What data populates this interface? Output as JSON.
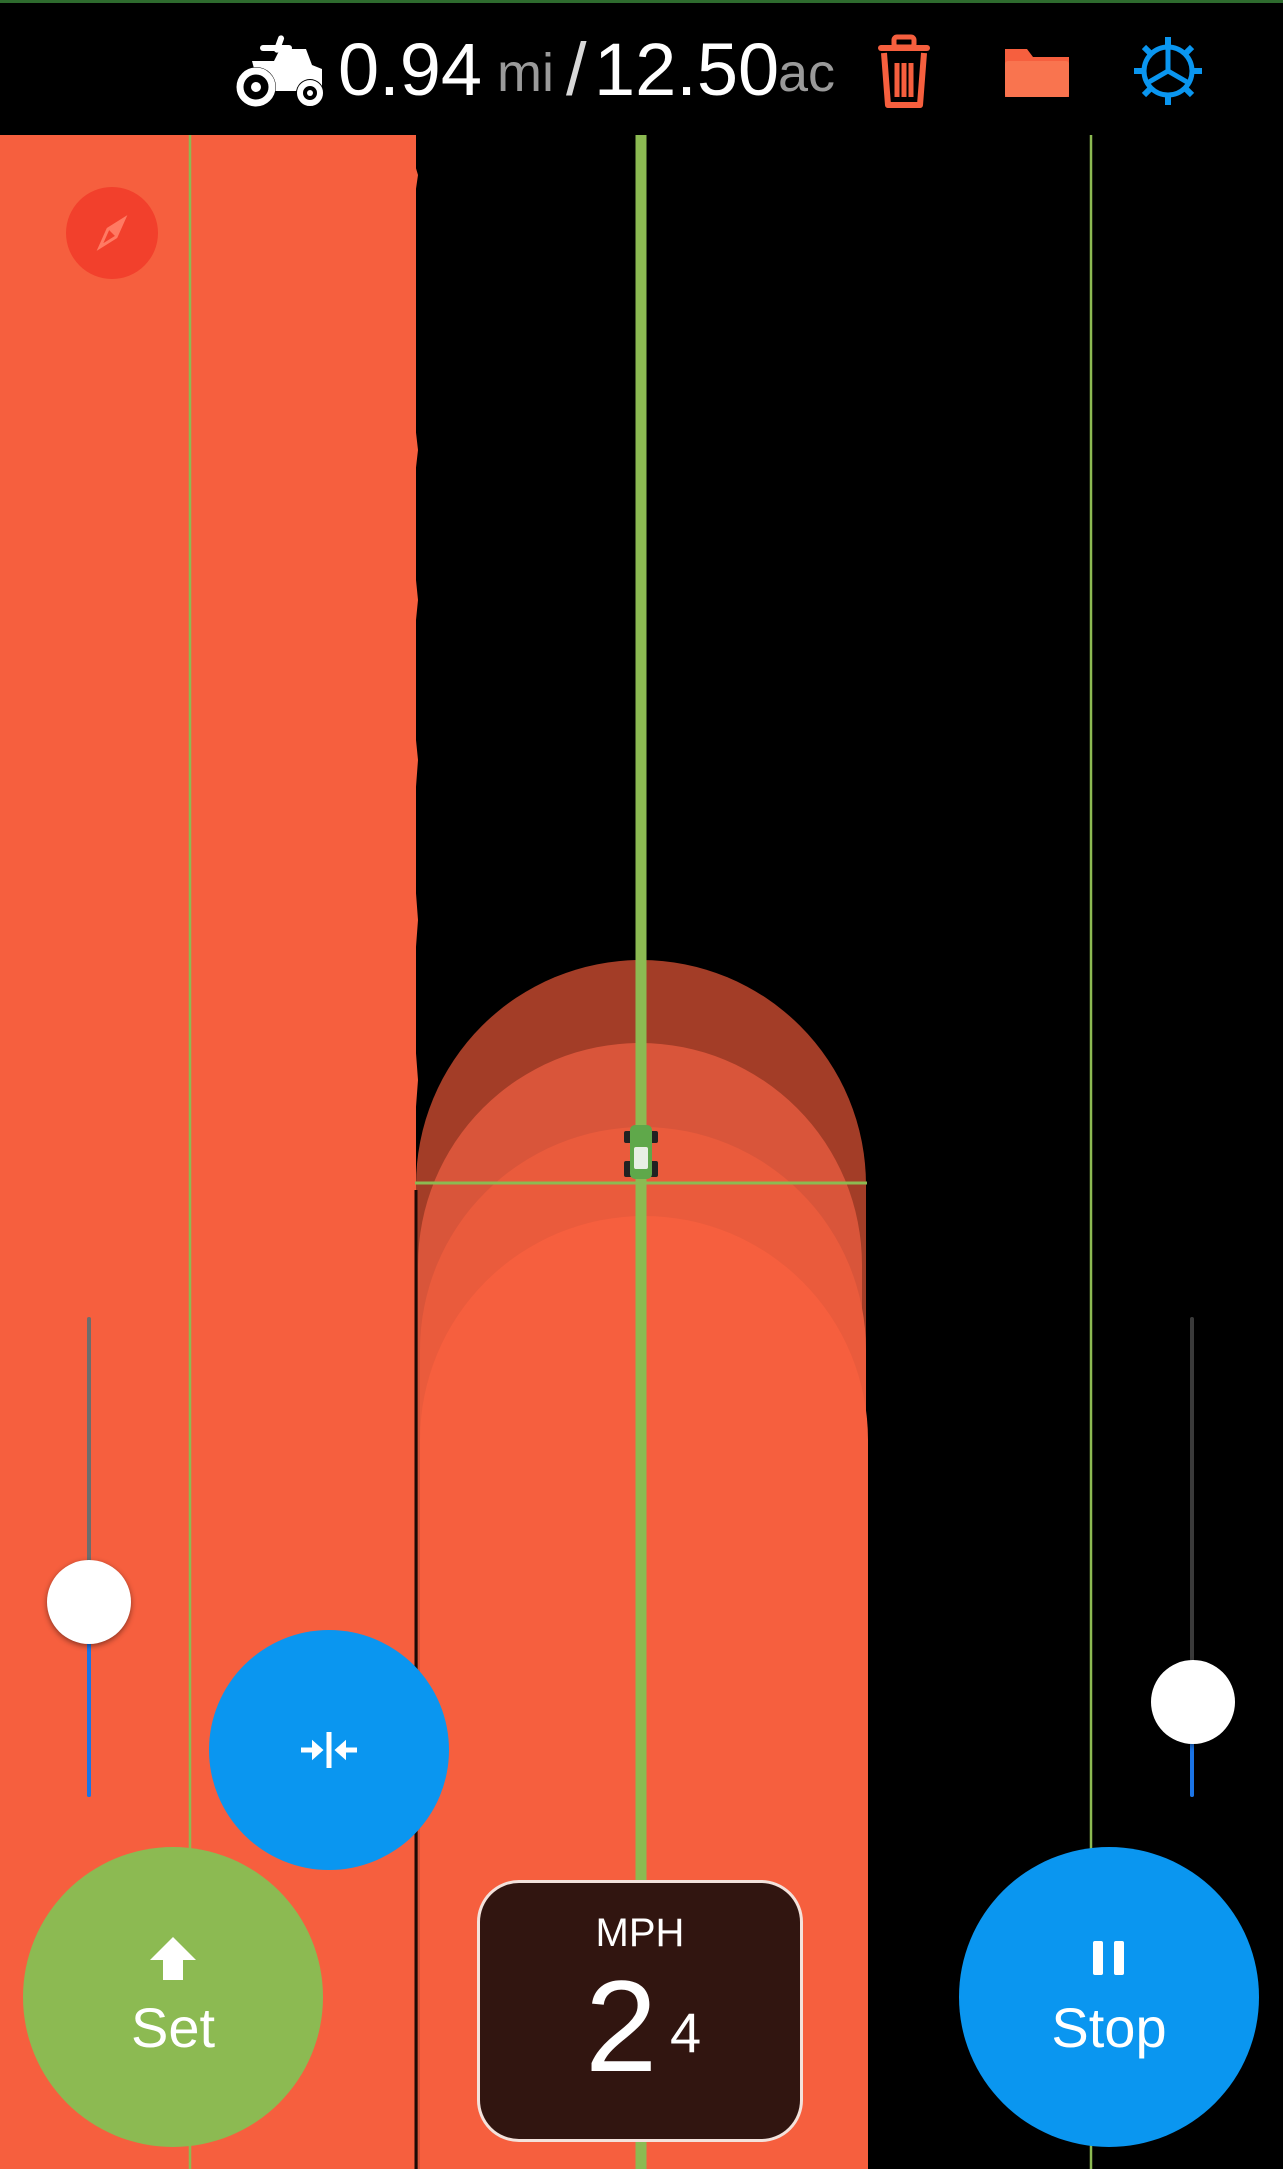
{
  "topbar": {
    "distance_value": "0.94",
    "distance_unit": "mi",
    "separator": "/",
    "area_value": "12.50",
    "area_unit": "ac",
    "icons": {
      "tractor": "tractor-icon",
      "trash": "trash-icon",
      "folder": "folder-icon",
      "settings": "gear-icon"
    }
  },
  "map": {
    "compass_icon": "compass-icon",
    "vehicle_icon": "tractor-vehicle-icon"
  },
  "controls": {
    "left_slider_level": 0.42,
    "right_slider_level": 0.2,
    "center_icon": "collapse-horizontal-icon",
    "set_label": "Set",
    "set_icon": "arrow-up-icon",
    "stop_label": "Stop",
    "stop_icon": "pause-icon"
  },
  "speed": {
    "unit": "MPH",
    "major": "2",
    "minor": "4"
  },
  "colors": {
    "background": "#000000",
    "coverage": "#f65f3e",
    "guide_line": "#8cba52",
    "accent_blue": "#0a96f0",
    "trash_orange": "#f65f3e",
    "compass_red": "#f2402c",
    "speed_panel": "#311510"
  }
}
